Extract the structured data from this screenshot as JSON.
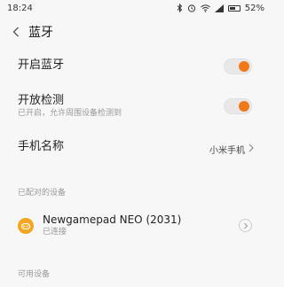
{
  "status_bar": {
    "time": "18:24",
    "battery_percent": "52%",
    "battery_level": 0.52,
    "icons": [
      "bluetooth-icon",
      "alarm-icon",
      "wifi-icon",
      "signal-icon",
      "battery-icon"
    ]
  },
  "header": {
    "title": "蓝牙",
    "back_icon": "chevron-left-icon"
  },
  "settings": {
    "bluetooth": {
      "label": "开启蓝牙",
      "enabled": true
    },
    "visibility": {
      "label": "开放检测",
      "sub": "已开启，允许周围设备检测到",
      "enabled": true
    },
    "phone_name": {
      "label": "手机名称",
      "value": "小米手机"
    }
  },
  "paired": {
    "section_label": "已配对的设备",
    "devices": [
      {
        "name": "Newgamepad NEO (2031)",
        "status": "已连接",
        "icon": "gamepad-icon"
      }
    ]
  },
  "available": {
    "section_label": "可用设备"
  },
  "colors": {
    "accent": "#f07a19",
    "device_icon_bg": "#f4a623",
    "background": "#f7f7f7"
  }
}
